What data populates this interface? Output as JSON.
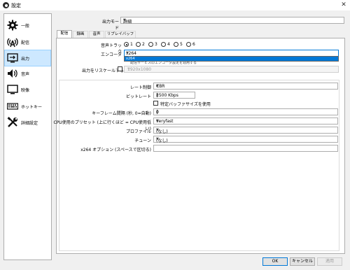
{
  "window": {
    "title": "設定",
    "close_glyph": "✕"
  },
  "sidebar": {
    "items": [
      {
        "label": "一般",
        "icon": "gear-icon"
      },
      {
        "label": "配信",
        "icon": "broadcast-antenna-icon"
      },
      {
        "label": "出力",
        "icon": "output-monitor-icon",
        "active": true
      },
      {
        "label": "音声",
        "icon": "speaker-icon"
      },
      {
        "label": "映像",
        "icon": "monitor-icon"
      },
      {
        "label": "ホットキー",
        "icon": "keyboard-icon"
      },
      {
        "label": "詳細設定",
        "icon": "tools-icon"
      }
    ]
  },
  "output_mode": {
    "label": "出力モード",
    "value": "詳細"
  },
  "tabs": [
    {
      "label": "配信",
      "active": true
    },
    {
      "label": "録画"
    },
    {
      "label": "音声"
    },
    {
      "label": "リプレイバッファ"
    }
  ],
  "audio_track": {
    "label": "音声トラック",
    "options": [
      "1",
      "2",
      "3",
      "4",
      "5",
      "6"
    ],
    "selected": "1"
  },
  "encoder": {
    "label": "エンコーダ",
    "value": "x264",
    "dropdown_item": "x264",
    "obscured_checkbox_text": "配信サービスのエンコーダ設定を適用する"
  },
  "rescale": {
    "label": "出力をリスケールする",
    "value": "1920x1080",
    "checked": false
  },
  "settings": {
    "rate_control": {
      "label": "レート制御",
      "value": "CBR"
    },
    "bitrate": {
      "label": "ビットレート",
      "value": "2500 Kbps"
    },
    "custom_buffer": {
      "label": "特定バッファサイズを使用",
      "checked": false
    },
    "keyframe": {
      "label": "キーフレーム間隔 (秒, 0=自動)",
      "value": "0"
    },
    "cpu_preset": {
      "label": "CPU使用のプリセット (上に行くほど = CPU使用低い)",
      "value": "veryfast"
    },
    "profile": {
      "label": "プロファイル",
      "value": "(なし)"
    },
    "tune": {
      "label": "チューン",
      "value": "(なし)"
    },
    "x264_options": {
      "label": "x264 オプション (スペースで区切る)",
      "value": ""
    }
  },
  "buttons": {
    "ok": "OK",
    "cancel": "キャンセル",
    "apply": "適用"
  }
}
